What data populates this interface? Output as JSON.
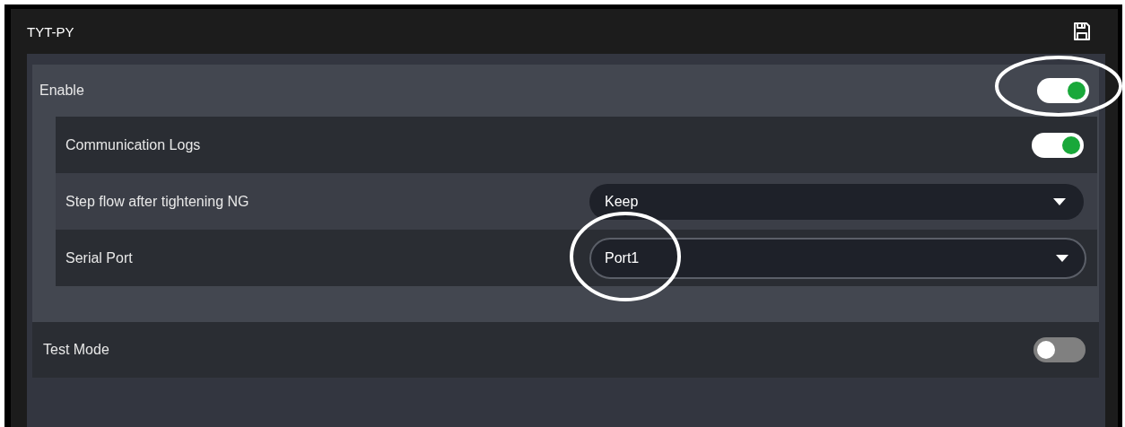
{
  "panel": {
    "title": "TYT-PY"
  },
  "settings": [
    {
      "kind": "toggle",
      "label": "Enable",
      "on": true,
      "children": [
        {
          "kind": "toggle",
          "label": "Communication Logs",
          "on": true
        },
        {
          "kind": "select",
          "label": "Step flow after tightening NG",
          "value": "Keep",
          "focused": false
        },
        {
          "kind": "select",
          "label": "Serial Port",
          "value": "Port1",
          "focused": true
        }
      ]
    },
    {
      "kind": "toggle",
      "label": "Test Mode",
      "on": false
    }
  ]
}
